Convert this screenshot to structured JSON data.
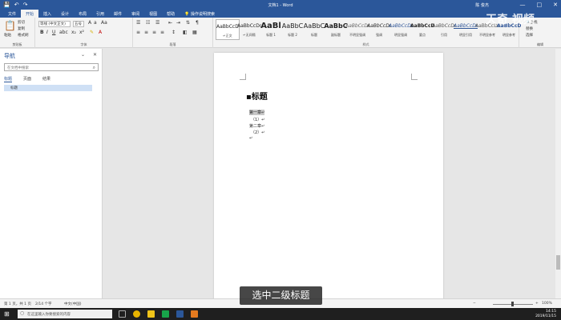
{
  "window": {
    "title": "文档1 - Word",
    "user": "陈 俊杰",
    "min": "—",
    "max": "□",
    "close": "✕"
  },
  "quick_access": [
    "save",
    "undo",
    "redo"
  ],
  "tabs": [
    {
      "label": "文件",
      "active": false
    },
    {
      "label": "开始",
      "active": true
    },
    {
      "label": "插入",
      "active": false
    },
    {
      "label": "设计",
      "active": false
    },
    {
      "label": "布局",
      "active": false
    },
    {
      "label": "引用",
      "active": false
    },
    {
      "label": "邮件",
      "active": false
    },
    {
      "label": "审阅",
      "active": false
    },
    {
      "label": "视图",
      "active": false
    },
    {
      "label": "帮助",
      "active": false
    }
  ],
  "tell_me": "操作说明搜索",
  "ribbon": {
    "clipboard": {
      "paste": "粘贴",
      "cut": "剪切",
      "copy": "复制",
      "format_painter": "格式刷",
      "label": "剪贴板"
    },
    "font": {
      "name": "等线 (中文正文)",
      "size": "五号",
      "label": "字体"
    },
    "paragraph": {
      "label": "段落"
    },
    "styles": {
      "label": "样式",
      "items": [
        {
          "sample": "AaBbCcDd",
          "name": "↵正文",
          "selected": true
        },
        {
          "sample": "AaBbCcDd",
          "name": "↵无间隔",
          "selected": false
        },
        {
          "sample": "AaBl",
          "name": "标题 1",
          "selected": false
        },
        {
          "sample": "AaBbC",
          "name": "标题 2",
          "selected": false
        },
        {
          "sample": "AaBbC",
          "name": "标题",
          "selected": false
        },
        {
          "sample": "AaBbC",
          "name": "副标题",
          "selected": false
        },
        {
          "sample": "AaBbCcDd",
          "name": "不明显强调",
          "selected": false
        },
        {
          "sample": "AaBbCcDd",
          "name": "强调",
          "selected": false
        },
        {
          "sample": "AaBbCcDd",
          "name": "明显强调",
          "selected": false
        },
        {
          "sample": "AaBbCcDd",
          "name": "要点",
          "selected": false
        },
        {
          "sample": "AaBbCcDd",
          "name": "引用",
          "selected": false
        },
        {
          "sample": "AaBbCcDd",
          "name": "明显引用",
          "selected": false
        },
        {
          "sample": "AaBbCcDd",
          "name": "不明显参考",
          "selected": false
        },
        {
          "sample": "AaBbCcDd",
          "name": "明显参考",
          "selected": false
        }
      ]
    },
    "editing": {
      "find": "查找",
      "replace": "替换",
      "select": "选择",
      "label": "编辑"
    }
  },
  "nav_pane": {
    "title": "导航",
    "search_placeholder": "在文档中搜索",
    "tabs": [
      "标题",
      "页面",
      "结果"
    ],
    "items": [
      "标题"
    ]
  },
  "document": {
    "heading": "标题",
    "lines": [
      "第一章↵",
      "（1）↵",
      "第二章↵",
      "（2）↵",
      "↵"
    ]
  },
  "status_bar": {
    "page": "第 1 页，共 1 页",
    "words": "2/14 个字",
    "language": "中文(中国)",
    "zoom": "100%"
  },
  "taskbar": {
    "search_placeholder": "在这里输入你要搜索的内容",
    "time": "14:15",
    "date": "2019/11/15"
  },
  "caption": "选中二级标题",
  "watermark": "天奇 视频"
}
